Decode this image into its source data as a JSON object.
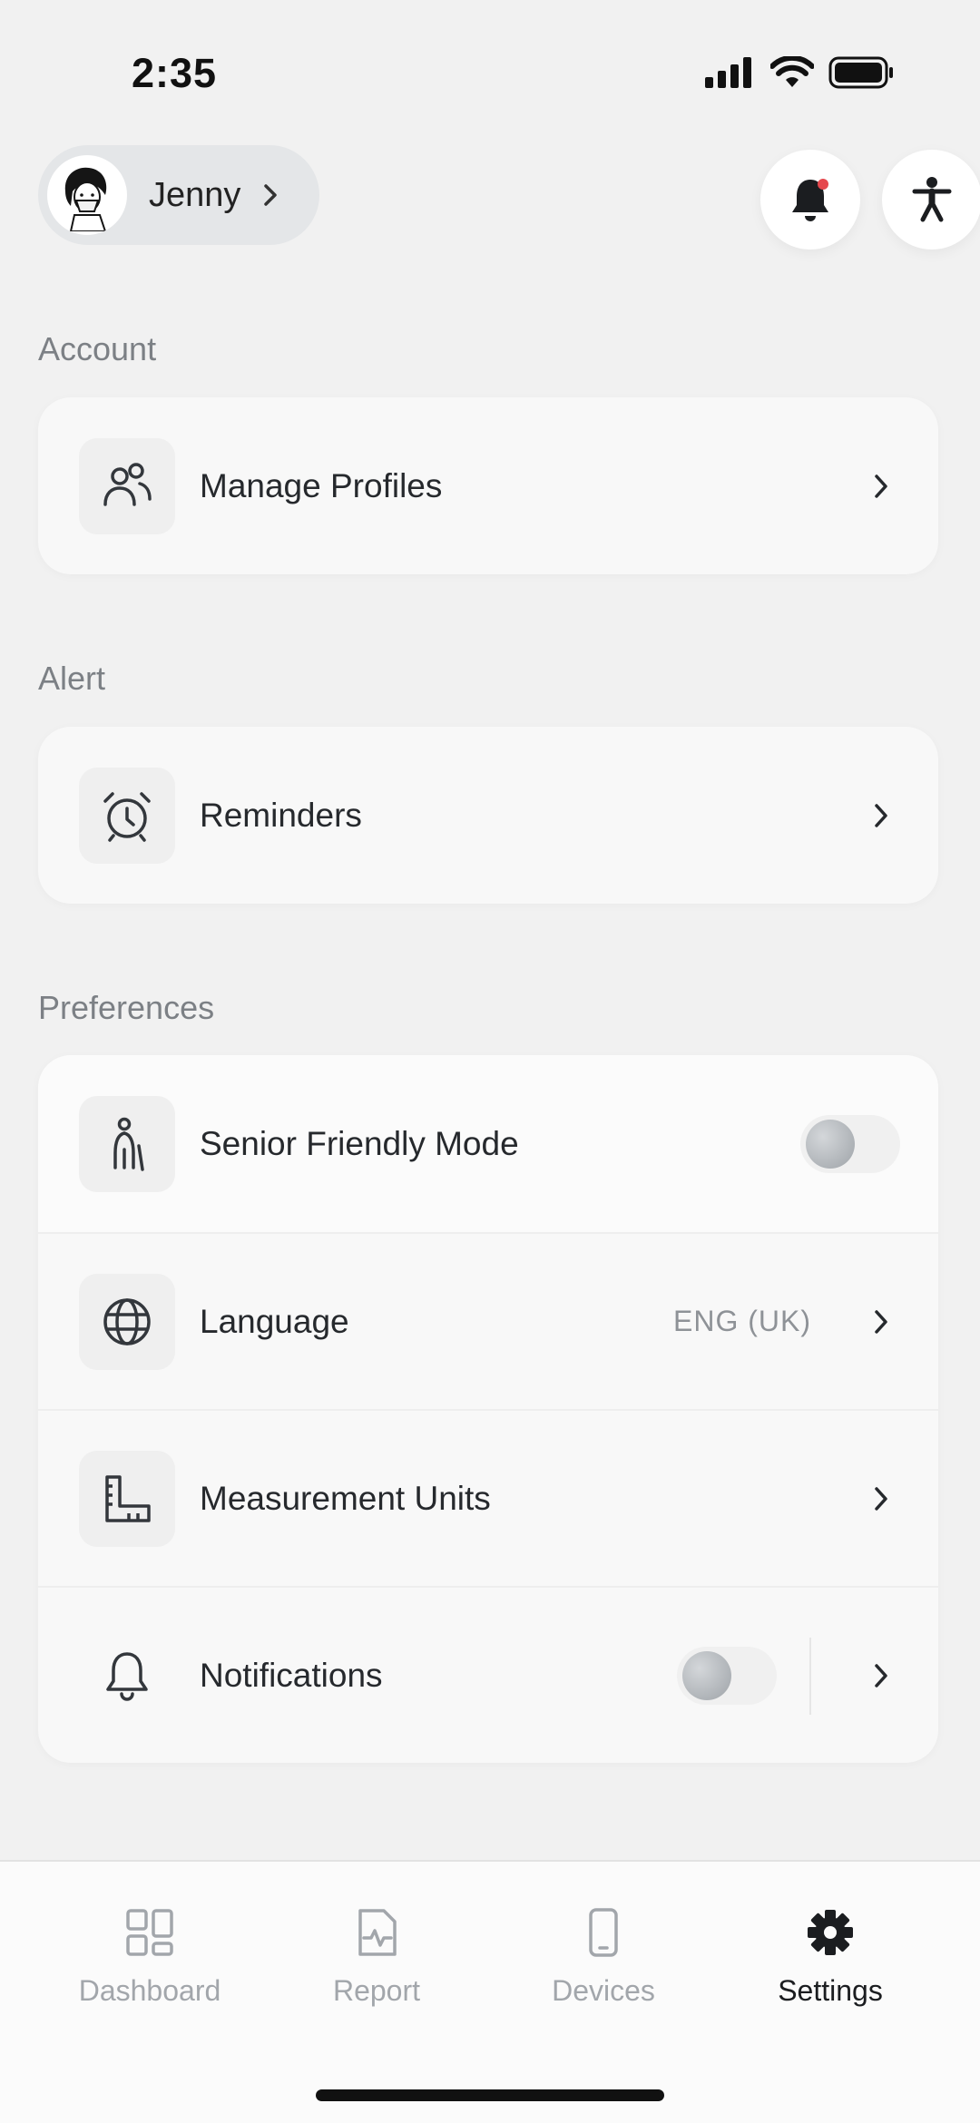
{
  "status": {
    "time": "2:35"
  },
  "profile": {
    "name": "Jenny"
  },
  "sections": {
    "account": {
      "title": "Account",
      "manage_profiles": "Manage Profiles"
    },
    "alert": {
      "title": "Alert",
      "reminders": "Reminders"
    },
    "preferences": {
      "title": "Preferences",
      "senior_mode": {
        "label": "Senior Friendly Mode",
        "enabled": false
      },
      "language": {
        "label": "Language",
        "value": "ENG (UK)"
      },
      "measurement": {
        "label": "Measurement Units"
      },
      "notifications": {
        "label": "Notifications",
        "enabled": false
      }
    }
  },
  "tabs": [
    {
      "label": "Dashboard",
      "icon": "grid-icon",
      "active": false
    },
    {
      "label": "Report",
      "icon": "report-icon",
      "active": false
    },
    {
      "label": "Devices",
      "icon": "phone-icon",
      "active": false
    },
    {
      "label": "Settings",
      "icon": "gear-icon",
      "active": true
    }
  ],
  "colors": {
    "notification_dot": "#e5484d",
    "active_tab": "#1b1d20",
    "inactive_tab": "#a2a6ab"
  }
}
